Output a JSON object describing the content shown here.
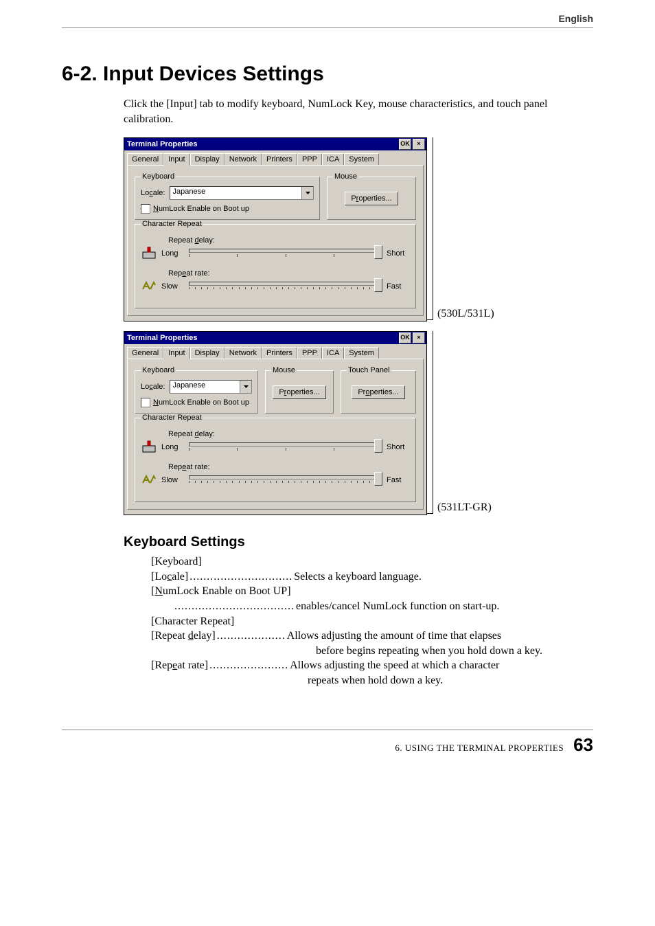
{
  "header": {
    "lang": "English"
  },
  "title": "6-2. Input Devices Settings",
  "intro": "Click the [Input] tab to modify keyboard, NumLock Key, mouse characteristics, and touch panel calibration.",
  "models": {
    "a": "(530L/531L)",
    "b": "(531LT-GR)"
  },
  "window": {
    "title": "Terminal Properties",
    "ok": "OK",
    "close": "×"
  },
  "tabs": [
    "General",
    "Input",
    "Display",
    "Network",
    "Printers",
    "PPP",
    "ICA",
    "System"
  ],
  "groups": {
    "keyboard": {
      "legend": "Keyboard",
      "locale_label": "Locale:",
      "locale_value": "Japanese",
      "numlock": "NumLock Enable on Boot up"
    },
    "mouse": {
      "legend": "Mouse",
      "btn": "Properties..."
    },
    "touch": {
      "legend": "Touch Panel",
      "btn": "Properties..."
    },
    "charrep": {
      "legend": "Character Repeat",
      "delay_label": "Repeat delay:",
      "delay_left": "Long",
      "delay_right": "Short",
      "rate_label": "Repeat rate:",
      "rate_left": "Slow",
      "rate_right": "Fast"
    }
  },
  "kbsettings": {
    "heading": "Keyboard Settings",
    "items": {
      "keyboard": "[Keyboard]",
      "locale_term": "[Locale]",
      "locale_desc": "Selects a keyboard language.",
      "numlock_term": "[NumLock Enable on Boot UP]",
      "numlock_desc": "enables/cancel NumLock function on start-up.",
      "charrep": "[Character Repeat]",
      "delay_term": "[Repeat delay]",
      "delay_desc": "Allows adjusting the amount of time that elapses",
      "delay_desc2": "before begins repeating when you hold down a key.",
      "rate_term": "[Repeat rate]",
      "rate_desc": "Allows adjusting the speed at which a character",
      "rate_desc2": "repeats when hold down a key."
    }
  },
  "footer": {
    "text": "6. USING THE TERMINAL PROPERTIES",
    "page": "63"
  }
}
